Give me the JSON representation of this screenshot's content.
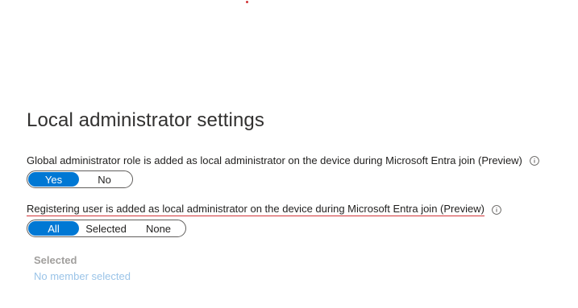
{
  "colors": {
    "accent": "#0078d4",
    "annotation_red": "#d13438",
    "muted_text": "#a19f9d",
    "disabled_link": "#9bc4e8"
  },
  "section": {
    "title": "Local administrator settings"
  },
  "global_admin_setting": {
    "label": "Global administrator role is added as local administrator on the device during Microsoft Entra join (Preview)",
    "info_icon": "info-icon",
    "options": [
      "Yes",
      "No"
    ],
    "selected": "Yes"
  },
  "registering_user_setting": {
    "label": "Registering user is added as local administrator on the device during Microsoft Entra join (Preview)",
    "info_icon": "info-icon",
    "options": [
      "All",
      "Selected",
      "None"
    ],
    "selected": "All"
  },
  "selected_members": {
    "heading": "Selected",
    "empty_text": "No member selected"
  }
}
